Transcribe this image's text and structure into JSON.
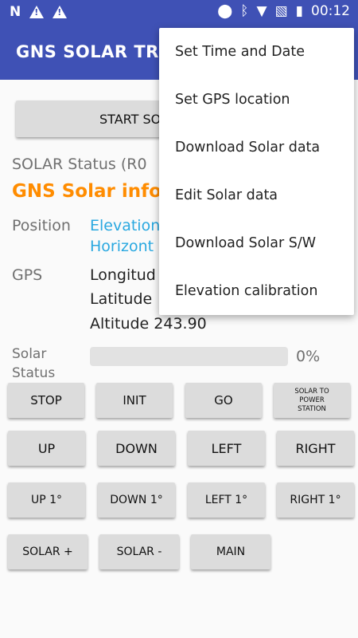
{
  "status_bar": {
    "left_icons": [
      "n-icon",
      "warning-icon",
      "warning-icon"
    ],
    "right_icons": [
      "location-icon",
      "bluetooth-icon",
      "wifi-icon",
      "no-sim-icon",
      "battery-charging-icon"
    ],
    "time": "00:12"
  },
  "app_bar": {
    "title": "GNS SOLAR TRA"
  },
  "main": {
    "start_button": "START SO",
    "solar_status_label": "SOLAR Status  (R0",
    "info_title": "GNS Solar info",
    "position_label": "Position",
    "elevation_text": "Elevation",
    "horizontal_text": "Horizont",
    "gps_label": "GPS",
    "longitude_text": "Longitud",
    "latitude_text": "Latitude",
    "altitude_text": "Altitude 243.90",
    "solar_status_line1": "Solar",
    "solar_status_line2": "Status",
    "progress_value": 0,
    "progress_text": "0%"
  },
  "buttons": {
    "stop": "STOP",
    "init": "INIT",
    "go": "GO",
    "solar_to_power_line1": "SOLAR TO",
    "solar_to_power_line2": "POWER",
    "solar_to_power_line3": "STATION",
    "up": "UP",
    "down": "DOWN",
    "left": "LEFT",
    "right": "RIGHT",
    "up_1": "UP 1°",
    "down_1": "DOWN 1°",
    "left_1": "LEFT 1°",
    "right_1": "RIGHT 1°",
    "solar_plus": "SOLAR +",
    "solar_minus": "SOLAR -",
    "main": "MAIN"
  },
  "menu": {
    "items": [
      "Set Time and Date",
      "Set GPS location",
      "Download Solar data",
      "Edit Solar data",
      "Download Solar S/W",
      "Elevation calibration"
    ]
  },
  "colors": {
    "primary": "#3f51b5",
    "accent_orange": "#ff8c00",
    "link_blue": "#29a8e0"
  }
}
